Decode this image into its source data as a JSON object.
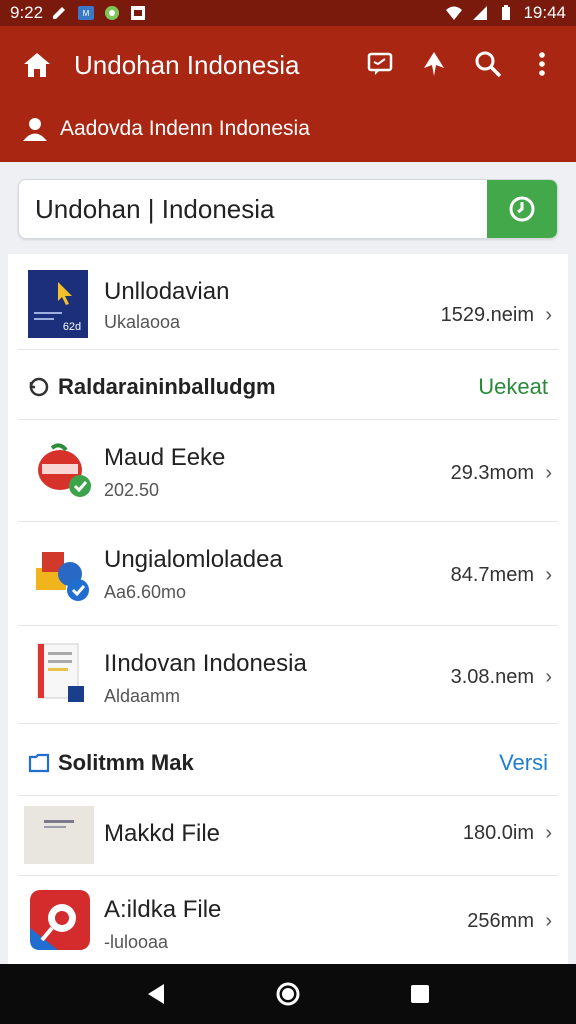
{
  "status_bar": {
    "time_left": "9:22",
    "time_right": "19:44",
    "icons": [
      "edit-icon",
      "app-icon",
      "android-icon",
      "image-icon",
      "wifi-icon",
      "signal-icon",
      "battery-icon"
    ]
  },
  "app_bar": {
    "title": "Undohan Indonesia",
    "subtitle": "Aadovda Indenn Indonesia",
    "actions": [
      "chat-icon",
      "pin-icon",
      "search-icon",
      "more-vert-icon"
    ],
    "color": "#a92612"
  },
  "search": {
    "value": "Undohan | Indonesia",
    "button_color": "#43a84a"
  },
  "top_item": {
    "name": "Unllodavian",
    "sub": "Ukalaooa",
    "size": "1529.neim",
    "thumb_text": "62d"
  },
  "section1": {
    "title": "Raldaraininballudgm",
    "link": "Uekeat",
    "link_color": "#2a8a3a"
  },
  "section1_items": [
    {
      "name": "Maud Eeke",
      "sub": "202.50",
      "size": "29.3mom"
    },
    {
      "name": "Ungialomloladea",
      "sub": "Aa6.60mo",
      "size": "84.7mem"
    },
    {
      "name": "IIndovan Indonesia",
      "sub": "Aldaamm",
      "size": "3.08.nem"
    }
  ],
  "section2": {
    "title": "Solitmm Mak",
    "link": "Versi",
    "link_color": "#1f7fcf"
  },
  "section2_items": [
    {
      "name": "Makkd File",
      "sub": "",
      "size": "180.0im"
    },
    {
      "name": "A:ildka File",
      "sub": "-lulooaa",
      "size": "256mm"
    }
  ],
  "nav_bar": {
    "buttons": [
      "back-icon",
      "home-icon",
      "recents-icon"
    ]
  }
}
